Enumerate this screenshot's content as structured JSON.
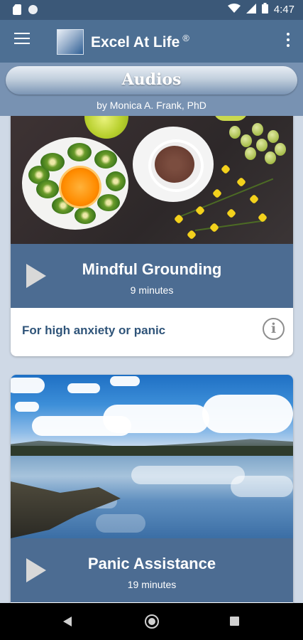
{
  "status_bar": {
    "time": "4:47"
  },
  "app_bar": {
    "title": "Excel At Life",
    "registered": "®"
  },
  "header": {
    "title": "Audios",
    "byline": "by Monica A. Frank, PhD"
  },
  "cards": [
    {
      "title": "Mindful Grounding",
      "duration": "9 minutes",
      "description": "For high anxiety or panic",
      "info_icon": "i"
    },
    {
      "title": "Panic Assistance",
      "duration": "19 minutes"
    }
  ],
  "colors": {
    "status_bar": "#3b5878",
    "app_bar": "#4d6f93",
    "player": "#4c6c92",
    "description_text": "#2f5479"
  }
}
